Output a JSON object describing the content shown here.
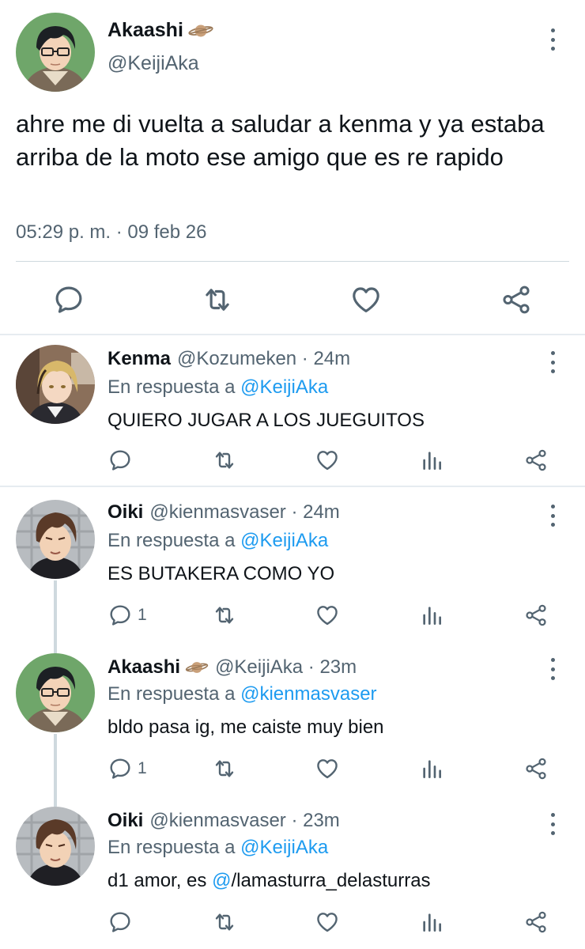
{
  "main_tweet": {
    "display_name": "Akaashi",
    "handle": "@KeijiAka",
    "text": "ahre me di vuelta a saludar a kenma y ya estaba arriba de la moto ese amigo que es re rapido",
    "timestamp": "05:29 p. m. · 09 feb 26",
    "actions": [
      "reply-icon",
      "retweet-icon",
      "like-icon",
      "share-icon"
    ]
  },
  "replies": [
    {
      "display_name": "Kenma",
      "handle": "@Kozumeken · 24m",
      "reply_prefix": "En respuesta a ",
      "reply_to": "@KeijiAka",
      "text": "QUIERO JUGAR A LOS JUEGUITOS",
      "reply_count": ""
    },
    {
      "display_name": "Oiki",
      "handle": "@kienmasvaser · 24m",
      "reply_prefix": "En respuesta a ",
      "reply_to": "@KeijiAka",
      "text": "ES BUTAKERA COMO YO",
      "reply_count": "1"
    },
    {
      "display_name": "Akaashi",
      "handle": "@KeijiAka · 23m",
      "reply_prefix": "En respuesta a ",
      "reply_to": "@kienmasvaser",
      "text": "bldo pasa ig, me caiste muy bien",
      "reply_count": "1"
    },
    {
      "display_name": "Oiki",
      "handle": "@kienmasvaser · 23m",
      "reply_prefix": "En respuesta a ",
      "reply_to": "@KeijiAka",
      "text_before": "d1 amor, es ",
      "text_mention": "@",
      "text_after": "/lamasturra_delasturras",
      "reply_count": ""
    }
  ],
  "colors": {
    "text_primary": "#0f1419",
    "text_secondary": "#536471",
    "link": "#1d9bf0",
    "divider": "#cfd9de"
  }
}
